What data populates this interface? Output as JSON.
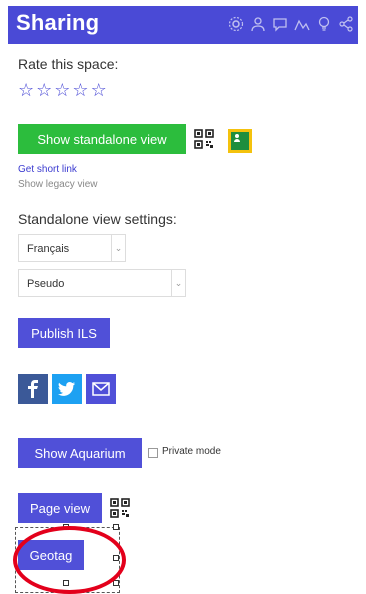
{
  "header": {
    "title": "Sharing"
  },
  "rate": {
    "label": "Rate this space:",
    "stars": [
      "☆",
      "☆",
      "☆",
      "☆",
      "☆"
    ]
  },
  "standalone": {
    "button_label": "Show standalone view",
    "short_link": "Get short link",
    "legacy_link": "Show legacy view"
  },
  "settings": {
    "label": "Standalone view settings:",
    "language": "Français",
    "name_mode": "Pseudo"
  },
  "publish": {
    "button_label": "Publish ILS"
  },
  "aquarium": {
    "button_label": "Show Aquarium",
    "private_label": "Private mode"
  },
  "page_view": {
    "button_label": "Page view"
  },
  "geotag": {
    "button_label": "Geotag"
  },
  "colors": {
    "accent": "#4a4ad6",
    "green": "#2cbd3d",
    "highlight": "#e3001b"
  }
}
